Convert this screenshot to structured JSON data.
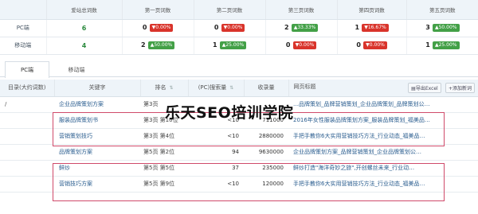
{
  "summary": {
    "headers": [
      "",
      "爱站总词数",
      "第一页词数",
      "第二页词数",
      "第三页词数",
      "第四页词数",
      "第五页词数"
    ],
    "rows": [
      {
        "label": "PC端",
        "total": "6",
        "pages": [
          {
            "count": "0",
            "change": "0.00%",
            "dir": "down"
          },
          {
            "count": "0",
            "change": "0.00%",
            "dir": "down"
          },
          {
            "count": "2",
            "change": "33.33%",
            "dir": "up"
          },
          {
            "count": "1",
            "change": "16.67%",
            "dir": "down"
          },
          {
            "count": "3",
            "change": "50.00%",
            "dir": "up"
          }
        ]
      },
      {
        "label": "移动端",
        "total": "4",
        "pages": [
          {
            "count": "2",
            "change": "50.00%",
            "dir": "up"
          },
          {
            "count": "1",
            "change": "25.00%",
            "dir": "up"
          },
          {
            "count": "0",
            "change": "0.00%",
            "dir": "down"
          },
          {
            "count": "0",
            "change": "0.00%",
            "dir": "down"
          },
          {
            "count": "1",
            "change": "25.00%",
            "dir": "up"
          }
        ]
      }
    ]
  },
  "tabs": [
    {
      "label": "PC端",
      "active": true
    },
    {
      "label": "移动端",
      "active": false
    }
  ],
  "keyword_table": {
    "headers": {
      "dir": "目录(大约词数)",
      "keyword": "关键字",
      "rank": "排名",
      "volume": "(PC)搜索量",
      "indexed": "收录量",
      "title": "网页标题"
    },
    "toolbar": {
      "export": "导出Excel",
      "add": "+添加新词"
    },
    "rows": [
      {
        "dir": "/",
        "keyword": "企业品牌策划方案",
        "rank": "第3页",
        "volume": "",
        "indexed": "",
        "title": "…品牌策划_品牌营销策划_企业品牌策划_品牌策划公…"
      },
      {
        "dir": "",
        "keyword": "服装品牌策划书",
        "rank": "第3页 第10位",
        "volume": "<10",
        "indexed": "711000",
        "title": "2016年女性服装品牌策划方案_服装品牌策划_福美品…"
      },
      {
        "dir": "",
        "keyword": "营销策划技巧",
        "rank": "第3页 第4位",
        "volume": "<10",
        "indexed": "2880000",
        "title": "手把手教你6大实用营销技巧方法_行业动态_福美品…"
      },
      {
        "dir": "",
        "keyword": "品牌策划方案",
        "rank": "第5页 第2位",
        "volume": "94",
        "indexed": "9630000",
        "title": "企业品牌策划方案_品牌营销策划_企业品牌策划公…"
      },
      {
        "dir": "",
        "keyword": "鲜炒",
        "rank": "第5页 第5位",
        "volume": "37",
        "indexed": "235000",
        "title": "鲜炒打造\"海洋奇妙之旅\",开创螺丝未来_行业动…"
      },
      {
        "dir": "",
        "keyword": "营销技巧方案",
        "rank": "第5页 第9位",
        "volume": "<10",
        "indexed": "120000",
        "title": "手把手教你6大实用营销技巧方法_行业动态_福美品…"
      }
    ]
  },
  "watermark": "乐天SEO培训学院"
}
